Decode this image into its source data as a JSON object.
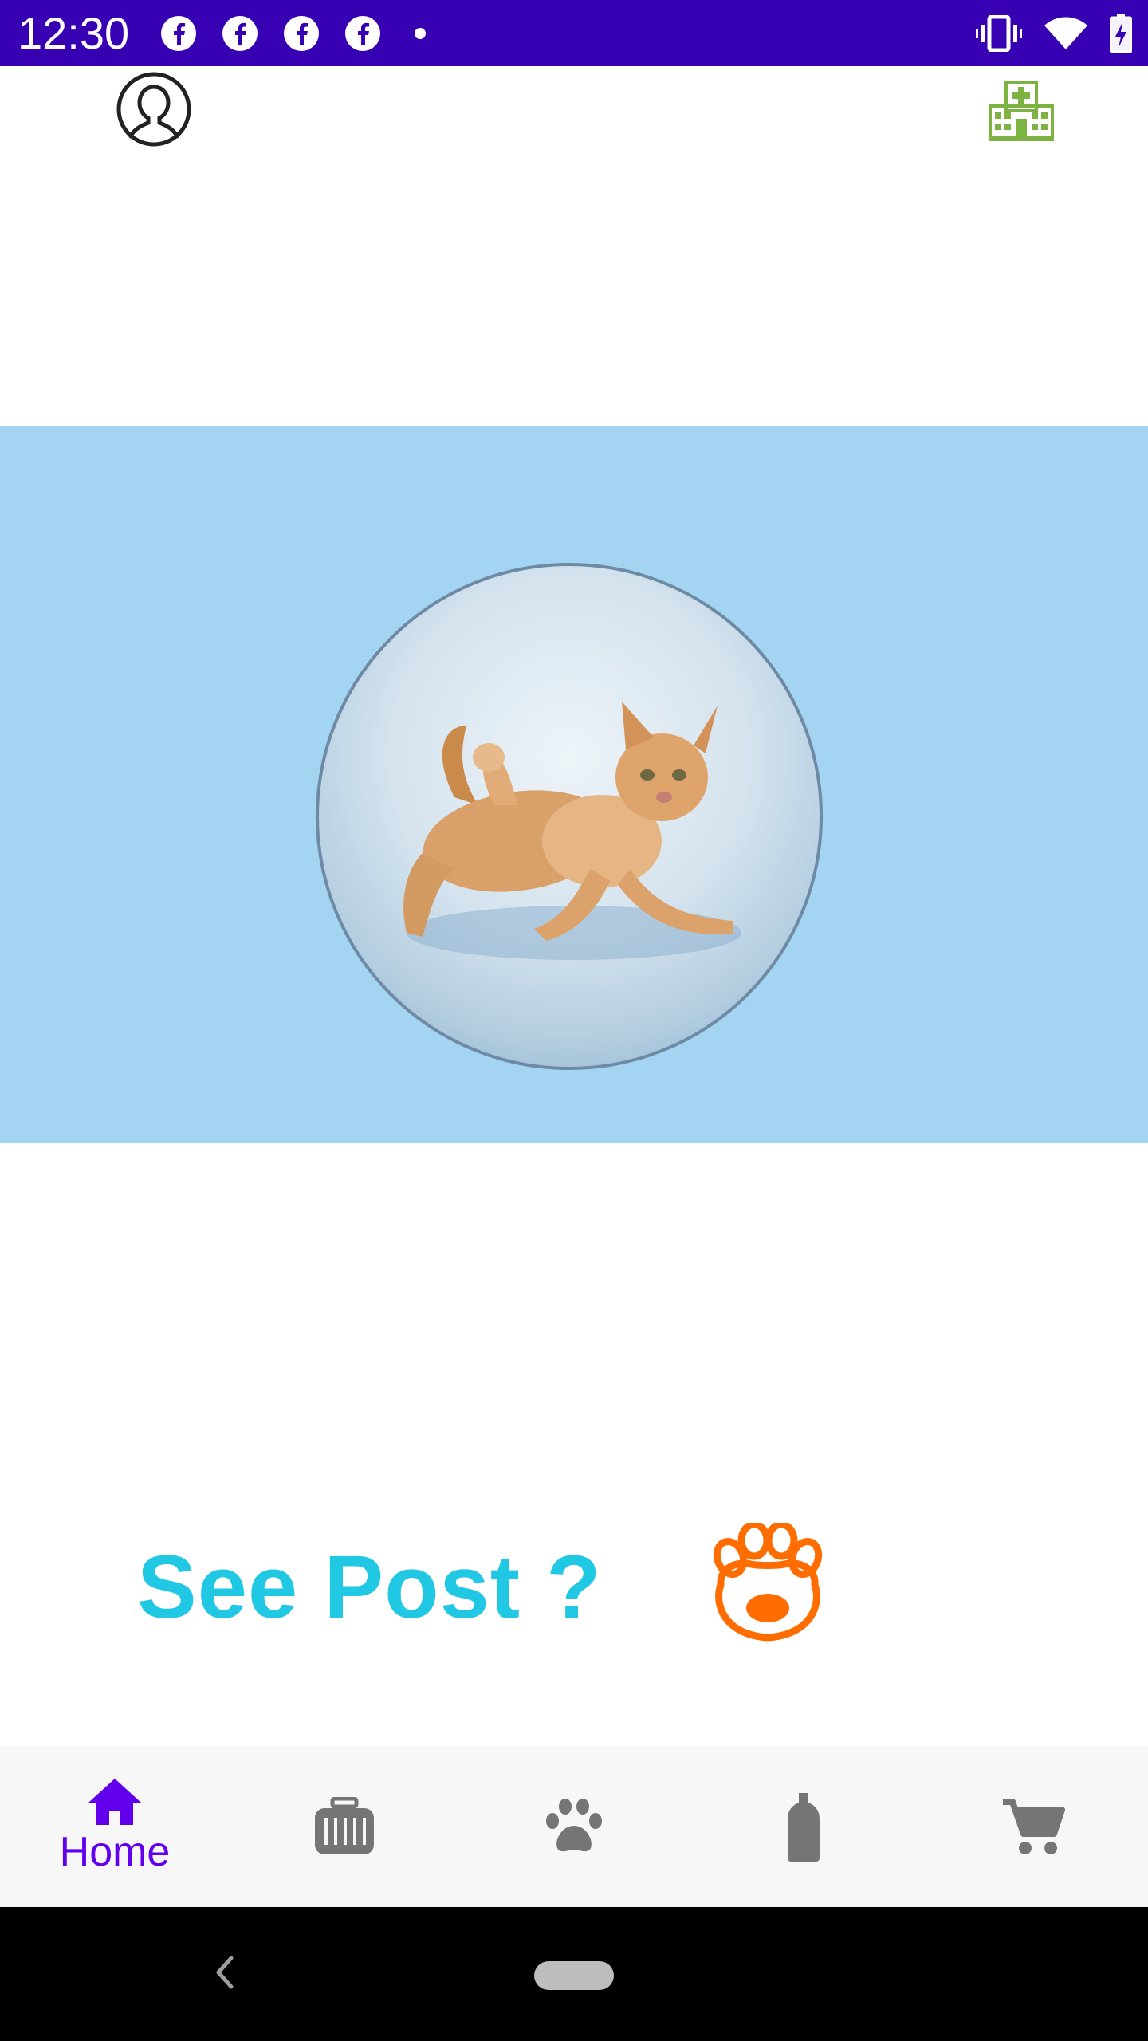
{
  "status_bar": {
    "time": "12:30",
    "notification_icons": [
      "facebook-icon",
      "facebook-icon",
      "facebook-icon",
      "facebook-icon",
      "dot-icon"
    ],
    "system_icons": [
      "vibrate-icon",
      "wifi-icon",
      "battery-charging-icon"
    ],
    "background_color": "#3700b3"
  },
  "top_bar": {
    "left_icon": "profile-icon",
    "right_icon": "hospital-icon",
    "hospital_color": "#7cb342"
  },
  "hero": {
    "background_color": "#a3d4f2",
    "image": "cat-photo"
  },
  "cta": {
    "label": "See Post ?",
    "color": "#20c8e4",
    "icon": "paw-icon",
    "icon_color": "#ff6d00"
  },
  "bottom_nav": {
    "active_color": "#6200ee",
    "inactive_color": "#757575",
    "items": [
      {
        "icon": "home-icon",
        "label": "Home",
        "active": true
      },
      {
        "icon": "pet-carrier-icon",
        "label": "",
        "active": false
      },
      {
        "icon": "paw-icon",
        "label": "",
        "active": false
      },
      {
        "icon": "bottle-icon",
        "label": "",
        "active": false
      },
      {
        "icon": "cart-icon",
        "label": "",
        "active": false
      }
    ]
  },
  "system_nav": {
    "buttons": [
      "back-icon",
      "home-pill"
    ]
  }
}
